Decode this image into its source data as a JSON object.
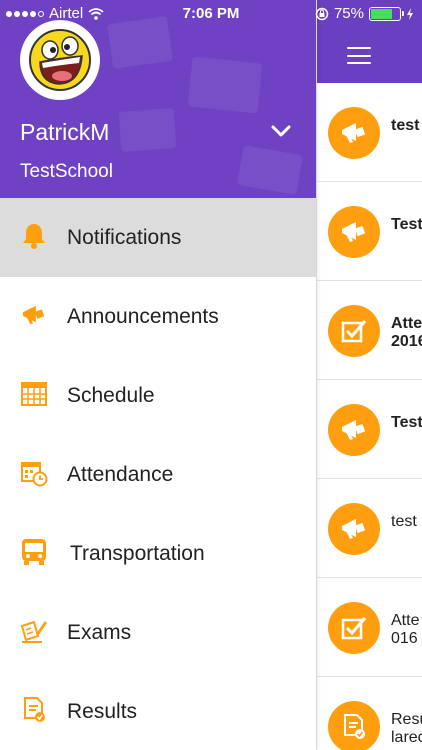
{
  "status_bar": {
    "carrier": "Airtel",
    "time": "7:06 PM",
    "battery": "75%",
    "battery_level": 0.75,
    "signal_bars": 4
  },
  "colors": {
    "header_purple": "#6f42c4",
    "accent_orange": "#ff9f10",
    "active_gray": "#dcdcdc"
  },
  "drawer": {
    "user_name": "PatrickM",
    "school_name": "TestSchool",
    "menu": [
      {
        "label": "Notifications",
        "icon": "bell-icon",
        "active": true
      },
      {
        "label": "Announcements",
        "icon": "megaphone-icon",
        "active": false
      },
      {
        "label": "Schedule",
        "icon": "calendar-icon",
        "active": false
      },
      {
        "label": "Attendance",
        "icon": "calendar-clock-icon",
        "active": false
      },
      {
        "label": "Transportation",
        "icon": "bus-icon",
        "active": false
      },
      {
        "label": "Exams",
        "icon": "exam-icon",
        "active": false
      },
      {
        "label": "Results",
        "icon": "results-icon",
        "active": false
      }
    ]
  },
  "notifications": [
    {
      "text": "test",
      "icon": "megaphone-icon",
      "bold": true
    },
    {
      "text": "Test",
      "icon": "megaphone-icon",
      "bold": true
    },
    {
      "text": "Atte\n2016",
      "icon": "checkbox-icon",
      "bold": true
    },
    {
      "text": "Test",
      "icon": "megaphone-icon",
      "bold": true
    },
    {
      "text": "test",
      "icon": "megaphone-icon",
      "bold": false
    },
    {
      "text": "Atte\n016",
      "icon": "checkbox-icon",
      "bold": false
    },
    {
      "text": "Resu\nlarec",
      "icon": "results-icon",
      "bold": false
    }
  ]
}
